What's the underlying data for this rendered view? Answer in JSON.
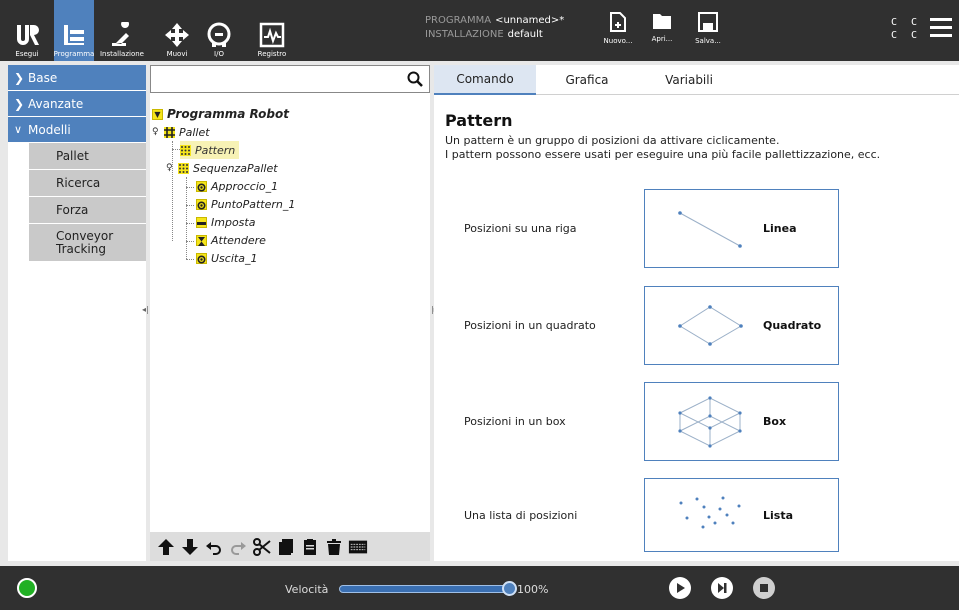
{
  "topbar": {
    "tabs": [
      {
        "label": "Esegui",
        "icon": "ur-logo-icon"
      },
      {
        "label": "Programma",
        "icon": "program-icon",
        "active": true
      },
      {
        "label": "Installazione",
        "icon": "robot-arm-icon"
      },
      {
        "label": "Muovi",
        "icon": "move-arrows-icon"
      },
      {
        "label": "I/O",
        "icon": "io-icon"
      },
      {
        "label": "Registro",
        "icon": "log-icon"
      }
    ],
    "program_key": "PROGRAMMA",
    "program_value": "<unnamed>*",
    "install_key": "INSTALLAZIONE",
    "install_value": "default",
    "file_buttons": [
      {
        "label": "Nuovo...",
        "icon": "new-file-icon"
      },
      {
        "label": "Apri...",
        "icon": "folder-icon"
      },
      {
        "label": "Salva...",
        "icon": "save-icon"
      }
    ],
    "cc_line1": "C C",
    "cc_line2": "C C"
  },
  "sidebar": {
    "sections": [
      {
        "label": "Base",
        "expanded": false
      },
      {
        "label": "Avanzate",
        "expanded": false
      },
      {
        "label": "Modelli",
        "expanded": true
      }
    ],
    "items": [
      "Pallet",
      "Ricerca",
      "Forza",
      "Conveyor Tracking"
    ]
  },
  "tree": {
    "search_placeholder": "",
    "root": "Programma Robot",
    "nodes": [
      {
        "label": "Pallet",
        "icon": "pallet-icon"
      },
      {
        "label": "Pattern",
        "icon": "pattern-icon",
        "selected": true
      },
      {
        "label": "SequenzaPallet",
        "icon": "pattern-icon"
      },
      {
        "label": "Approccio_1",
        "icon": "waypoint-icon"
      },
      {
        "label": "PuntoPattern_1",
        "icon": "waypoint-icon"
      },
      {
        "label": "Imposta",
        "icon": "set-icon"
      },
      {
        "label": "Attendere",
        "icon": "hourglass-icon"
      },
      {
        "label": "Uscita_1",
        "icon": "waypoint-icon"
      }
    ],
    "toolbar_icons": [
      "move-up-icon",
      "move-down-icon",
      "undo-icon",
      "redo-icon",
      "cut-icon",
      "copy-icon",
      "paste-icon",
      "delete-icon",
      "suppress-icon"
    ]
  },
  "right": {
    "tabs": [
      "Comando",
      "Grafica",
      "Variabili"
    ],
    "active_tab": "Comando",
    "title": "Pattern",
    "desc_line1": "Un pattern è un gruppo di posizioni da attivare ciclicamente.",
    "desc_line2": "I pattern possono essere usati per eseguire una più facile pallettizzazione, ecc.",
    "patterns": [
      {
        "label": "Posizioni su una riga",
        "button": "Linea"
      },
      {
        "label": "Posizioni in un quadrato",
        "button": "Quadrato"
      },
      {
        "label": "Posizioni in un box",
        "button": "Box"
      },
      {
        "label": "Una lista di posizioni",
        "button": "Lista"
      }
    ]
  },
  "bottombar": {
    "speed_label": "Velocità",
    "speed_value": "100%",
    "speed_fraction": 1.0,
    "status_color": "#21b024"
  },
  "colors": {
    "accent": "#4f81bd",
    "topbar": "#303030",
    "selection_yellow": "#f5e51a"
  }
}
